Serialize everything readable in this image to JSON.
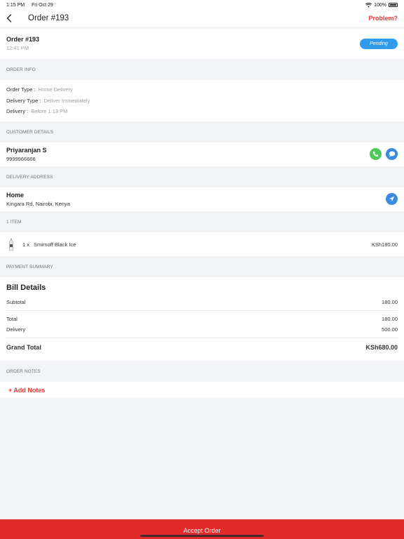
{
  "status_bar": {
    "time": "1:15 PM",
    "date": "Fri Oct 29",
    "battery": "100%"
  },
  "nav": {
    "title": "Order #193",
    "problem": "Problem?"
  },
  "order": {
    "number": "Order #193",
    "time": "12:41 PM",
    "status": "Pending"
  },
  "sections": {
    "order_info": "ORDER INFO",
    "customer": "CUSTOMER DETAILS",
    "address": "DELIVERY ADDRESS",
    "items": "1 ITEM",
    "payment": "PAYMENT SUMMARY",
    "notes": "ORDER NOTES"
  },
  "order_info": [
    {
      "label": "Order Type :",
      "value": "Home Delivery"
    },
    {
      "label": "Delivery Type :",
      "value": "Deliver Immediately"
    },
    {
      "label": "Delivery :",
      "value": "Before 1:13 PM"
    }
  ],
  "customer": {
    "name": "Priyaranjan S",
    "phone": "9999966666"
  },
  "address": {
    "label": "Home",
    "line": "Kingara Rd, Nairobi, Kenya"
  },
  "item": {
    "qty": "1 x",
    "name": "Smirnoff Black Ice",
    "price": "KSh180.00"
  },
  "bill": {
    "title": "Bill Details",
    "subtotal_label": "Subtotal",
    "subtotal": "180.00",
    "total_label": "Total",
    "total": "180.00",
    "delivery_label": "Delivery",
    "delivery": "500.00",
    "grand_label": "Grand Total",
    "grand": "KSh680.00"
  },
  "notes": {
    "add_label": "+ Add Notes"
  },
  "footer": {
    "accept_label": "Accept Order"
  },
  "colors": {
    "accent_red": "#e12b2b",
    "pending_blue": "#2f9bea",
    "phone_green": "#4ccb5a",
    "chat_blue": "#3a8be0"
  }
}
